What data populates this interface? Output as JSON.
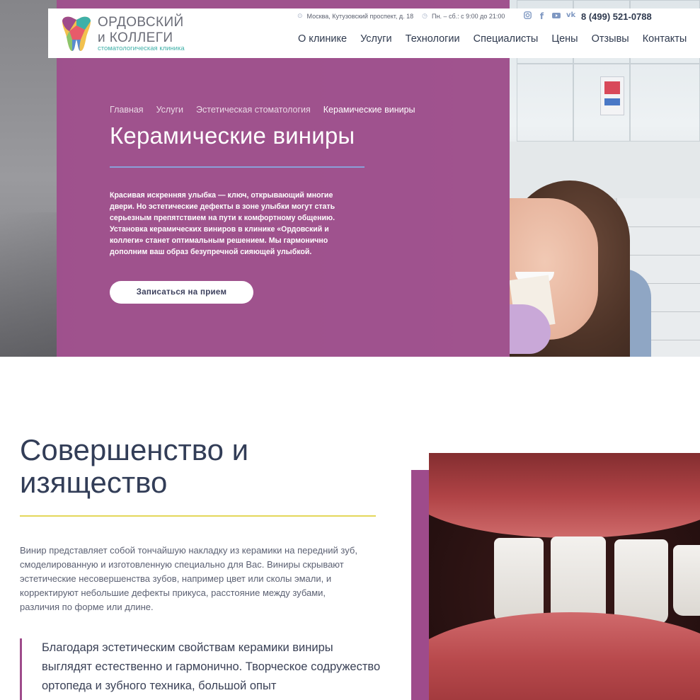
{
  "header": {
    "logo": {
      "line1": "ОРДОВСКИЙ",
      "line2": "и КОЛЛЕГИ",
      "subtitle": "стоматологическая клиника",
      "icon": "tooth-logo-icon"
    },
    "address": "Москва, Кутузовский проспект, д. 18",
    "hours": "Пн. – сб.: с 9:00 до 21:00",
    "social": [
      "instagram-icon",
      "facebook-icon",
      "youtube-icon",
      "vk-icon"
    ],
    "phone": "8 (499) 521-0788",
    "nav": [
      {
        "label": "О клинике"
      },
      {
        "label": "Услуги"
      },
      {
        "label": "Технологии"
      },
      {
        "label": "Специалисты"
      },
      {
        "label": "Цены"
      },
      {
        "label": "Отзывы"
      },
      {
        "label": "Контакты"
      }
    ]
  },
  "hero": {
    "breadcrumb": [
      {
        "label": "Главная"
      },
      {
        "label": "Услуги"
      },
      {
        "label": "Эстетическая стоматология"
      },
      {
        "label": "Керамические виниры"
      }
    ],
    "title": "Керамические виниры",
    "text": "Красивая искренняя улыбка — ключ, открывающий многие двери. Но эстетические дефекты в зоне улыбки могут стать серьезным препятствием на пути к комфортному общению. Установка керамических виниров в клинике «Ордовский и коллеги» станет оптимальным решением. Мы гармонично дополним ваш образ безупречной сияющей улыбкой.",
    "cta_label": "Записаться на прием"
  },
  "section": {
    "title": "Совершенство и изящество",
    "text": "Винир представляет собой тончайшую накладку из керамики на передний зуб, смоделированную и изготовленную специально для Вас. Виниры скрывают эстетические несовершенства зубов, например цвет или сколы эмали, и корректируют небольшие дефекты прикуса, расстояние между зубами, различия по форме или длине.",
    "quote": "Благодаря эстетическим свойствам керамики виниры выглядят естественно и гармонично. Творческое содружество ортопеда и зубного техника, большой опыт"
  },
  "colors": {
    "brand_purple": "#9e4b8b",
    "accent_yellow": "#e4d75a",
    "accent_blue": "#8aa0d8",
    "text_dark": "#2f3a4f"
  }
}
